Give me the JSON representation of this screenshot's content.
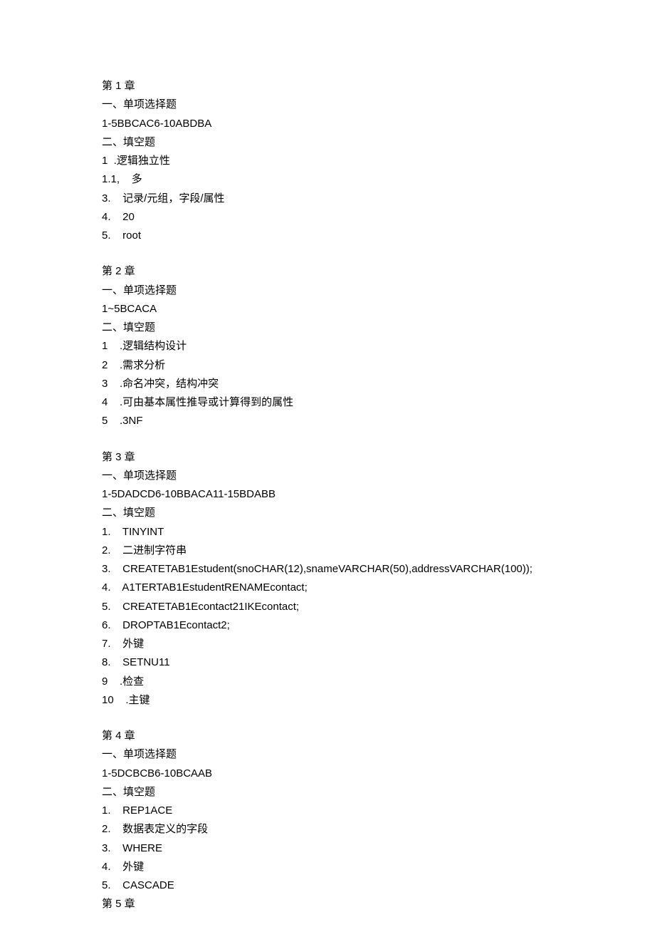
{
  "chapters": [
    {
      "title": "第 1 章",
      "mc_heading": "一、单项选择题",
      "mc_answers": "1-5BBCAC6-10ABDBA",
      "fb_heading": "二、填空题",
      "items": [
        "1  .逻辑独立性",
        "1.1,    多",
        "3.    记录/元组，字段/属性",
        "4.    20",
        "5.    root"
      ]
    },
    {
      "title": "第 2 章",
      "mc_heading": "一、单项选择题",
      "mc_answers": "1~5BCACA",
      "fb_heading": "二、填空题",
      "items": [
        "1    .逻辑结构设计",
        "2    .需求分析",
        "3    .命名冲突，结构冲突",
        "4    .可由基本属性推导或计算得到的属性",
        "5    .3NF"
      ]
    },
    {
      "title": "第 3 章",
      "mc_heading": "一、单项选择题",
      "mc_answers": "1-5DADCD6-10BBACA11-15BDABB",
      "fb_heading": "二、填空题",
      "items": [
        "1.    TINYINT",
        "2.    二进制字符串",
        "3.    CREATETAB1Estudent(snoCHAR(12),snameVARCHAR(50),addressVARCHAR(100));",
        "4.    A1TERTAB1EstudentRENAMEcontact;",
        "5.    CREATETAB1Econtact21IKEcontact;",
        "6.    DROPTAB1Econtact2;",
        "7.    外键",
        "8.    SETNU11",
        "9    .检查",
        "10    .主键"
      ]
    },
    {
      "title": "第 4 章",
      "mc_heading": "一、单项选择题",
      "mc_answers": "1-5DCBCB6-10BCAAB",
      "fb_heading": "二、填空题",
      "items": [
        "1.    REP1ACE",
        "2.    数据表定义的字段",
        "3.    WHERE",
        "4.    外键",
        "5.    CASCADE"
      ],
      "trailing": "第 5 章"
    }
  ]
}
